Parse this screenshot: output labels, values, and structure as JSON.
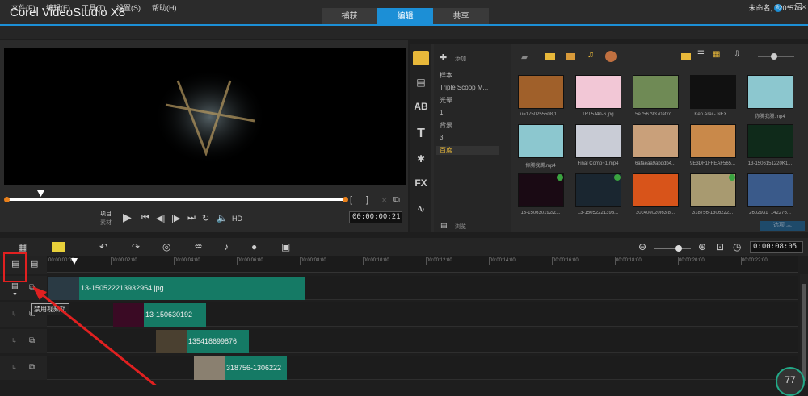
{
  "app": {
    "title": "Corel VideoStudio X8",
    "project_info": "未命名, 720*576"
  },
  "tabs": [
    {
      "label": "捕获"
    },
    {
      "label": "编辑",
      "active": true
    },
    {
      "label": "共享"
    }
  ],
  "menu": [
    "文件(F)",
    "编辑(E)",
    "工具(T)",
    "设置(S)",
    "帮助(H)"
  ],
  "accent": "#1c8fd6",
  "preview": {
    "mode_project": "项目",
    "mode_clip": "素材",
    "hd": "HD",
    "timecode": "00:00:00:21"
  },
  "library": {
    "add_label": "添加",
    "browse_label": "浏览",
    "options_label": "选项",
    "folders": [
      "样本",
      "Triple Scoop M...",
      "光晕",
      "1",
      "背景",
      "3",
      "百度"
    ],
    "selected_folder": "百度",
    "items": [
      {
        "name": "u=1750255508,1...",
        "color": "#a0602a"
      },
      {
        "name": "1RT5J40-6.jpg",
        "color": "#f2c7d6"
      },
      {
        "name": "5e75679370af7c...",
        "color": "#6f8a55"
      },
      {
        "name": "Ken Arai - NEX...",
        "color": "#111111"
      },
      {
        "name": "你腾我腾.mp4",
        "color": "#8cc7cf"
      },
      {
        "name": "你腾我腾.mp4",
        "color": "#8cc7cf"
      },
      {
        "name": "Final Comp~1.mp4",
        "color": "#c9ccd6"
      },
      {
        "name": "6afaeaa9abddb4...",
        "color": "#c9a07a"
      },
      {
        "name": "9E3DF1FFEAF565...",
        "color": "#c9894a"
      },
      {
        "name": "13-1506151220K1...",
        "color": "#0f2a1a"
      },
      {
        "name": "13-150630192IZ...",
        "color": "#1a0a14",
        "checked": true
      },
      {
        "name": "13-15052221393...",
        "color": "#1a2630",
        "checked": true
      },
      {
        "name": "30c40e020f63f8...",
        "color": "#d8541a"
      },
      {
        "name": "318756-1306222...",
        "color": "#a89a70",
        "checked": true
      },
      {
        "name": "2602931_142276...",
        "color": "#3a5a8a"
      }
    ]
  },
  "timeline": {
    "timecode": "0:00:08:05",
    "ruler": [
      "00:00:00:00",
      "00:00:02:00",
      "00:00:04:00",
      "00:00:06:00",
      "00:00:08:00",
      "00:00:10:00",
      "00:00:12:00",
      "00:00:14:00",
      "00:00:16:00",
      "00:00:18:00",
      "00:00:20:00",
      "00:00:22:00"
    ],
    "clips": [
      {
        "name": "13-150522213932954.jpg",
        "color": "#2a3a44"
      },
      {
        "name": "13-150630192",
        "color": "#3a0a24"
      },
      {
        "name": "135418699876",
        "color": "#4a4030"
      },
      {
        "name": "318756-1306222",
        "color": "#8a8070"
      }
    ],
    "tooltip": "禁用视频轨",
    "zoom_badge": "77"
  }
}
